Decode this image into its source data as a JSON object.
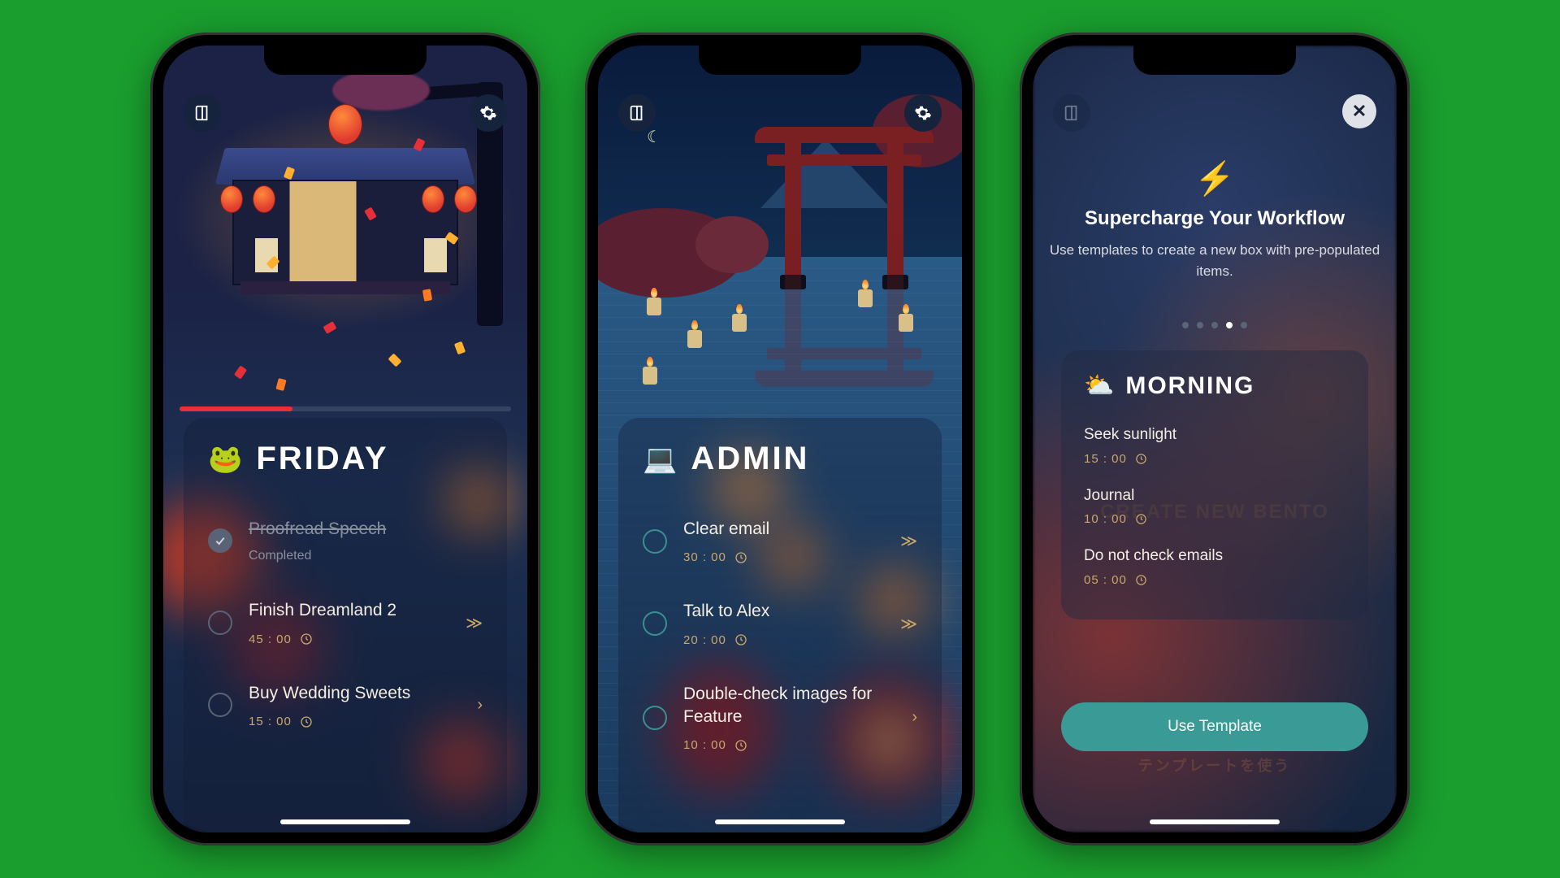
{
  "phone1": {
    "title": "FRIDAY",
    "emoji": "🐸",
    "tasks": [
      {
        "name": "Proofread Speech",
        "status": "Completed",
        "done": true
      },
      {
        "name": "Finish Dreamland 2",
        "time": "45 : 00",
        "done": false
      },
      {
        "name": "Buy Wedding Sweets",
        "time": "15 : 00",
        "done": false
      }
    ]
  },
  "phone2": {
    "title": "ADMIN",
    "emoji": "💻",
    "tasks": [
      {
        "name": "Clear email",
        "time": "30 : 00"
      },
      {
        "name": "Talk to Alex",
        "time": "20 : 00"
      },
      {
        "name": "Double-check images for Feature",
        "time": "10 : 00"
      }
    ]
  },
  "phone3": {
    "heading": "Supercharge Your Workflow",
    "sub": "Use templates to create a new box with pre-populated items.",
    "pageIndex": 3,
    "pageCount": 5,
    "template": {
      "title": "MORNING",
      "emoji": "⛅",
      "items": [
        {
          "name": "Seek sunlight",
          "time": "15 : 00"
        },
        {
          "name": "Journal",
          "time": "10 : 00"
        },
        {
          "name": "Do not check emails",
          "time": "05 : 00"
        }
      ]
    },
    "ghost1": "CREATE NEW BENTO",
    "ghost2": "USE TEMPLATE",
    "ghost3": "テンプレートを使う",
    "cta": "Use Template"
  }
}
